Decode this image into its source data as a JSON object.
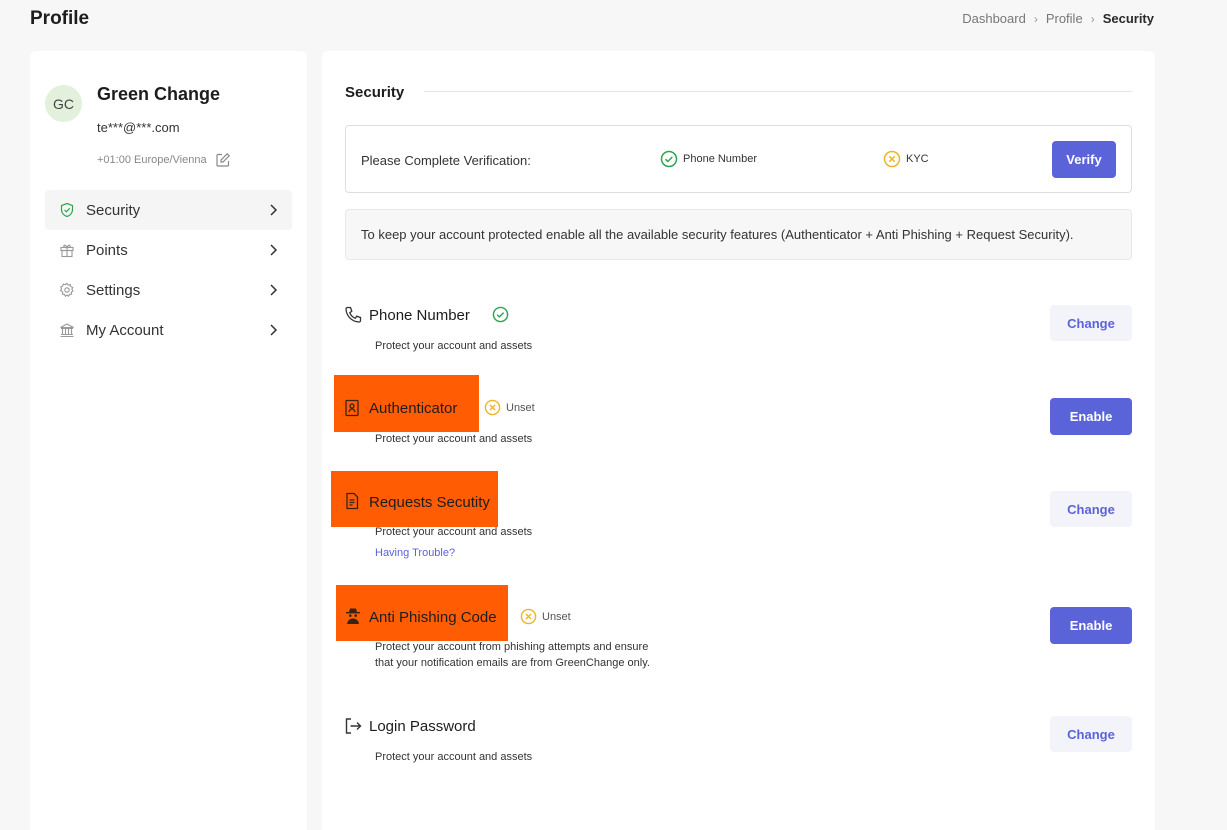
{
  "header": {
    "title": "Profile",
    "breadcrumb": [
      "Dashboard",
      "Profile",
      "Security"
    ]
  },
  "user": {
    "initials": "GC",
    "name": "Green Change",
    "email": "te***@***.com",
    "timezone": "+01:00 Europe/Vienna"
  },
  "menu": [
    {
      "label": "Security",
      "icon": "shield-icon",
      "active": true
    },
    {
      "label": "Points",
      "icon": "gift-icon",
      "active": false
    },
    {
      "label": "Settings",
      "icon": "gear-icon",
      "active": false
    },
    {
      "label": "My Account",
      "icon": "bank-icon",
      "active": false
    }
  ],
  "security": {
    "title": "Security",
    "verification": {
      "label": "Please Complete Verification:",
      "items": [
        {
          "label": "Phone Number",
          "status": "done"
        },
        {
          "label": "KYC",
          "status": "pending"
        }
      ],
      "button": "Verify"
    },
    "info": "To keep your account protected enable all the available security features (Authenticator + Anti Phishing + Request Security).",
    "features": [
      {
        "title": "Phone Number",
        "icon": "phone-icon",
        "status": "",
        "desc": "Protect your account and assets",
        "button": "Change"
      },
      {
        "title": "Authenticator",
        "icon": "authenticator-icon",
        "status": "Unset",
        "desc": "Protect your account and assets",
        "button": "Enable"
      },
      {
        "title": "Requests Secutity",
        "icon": "document-icon",
        "status": "",
        "desc": "Protect your account and assets",
        "link": "Having Trouble?",
        "button": "Change"
      },
      {
        "title": "Anti Phishing Code",
        "icon": "spy-icon",
        "status": "Unset",
        "desc1": "Protect your account from phishing attempts and ensure",
        "desc2": "that your notification emails are from GreenChange only.",
        "button": "Enable"
      },
      {
        "title": "Login Password",
        "icon": "logout-icon",
        "status": "",
        "desc": "Protect your account and assets",
        "button": "Change"
      }
    ]
  },
  "colors": {
    "accent": "#5b63d9",
    "success": "#2da44e",
    "warning": "#f0b429",
    "highlight": "#ff5c04"
  }
}
